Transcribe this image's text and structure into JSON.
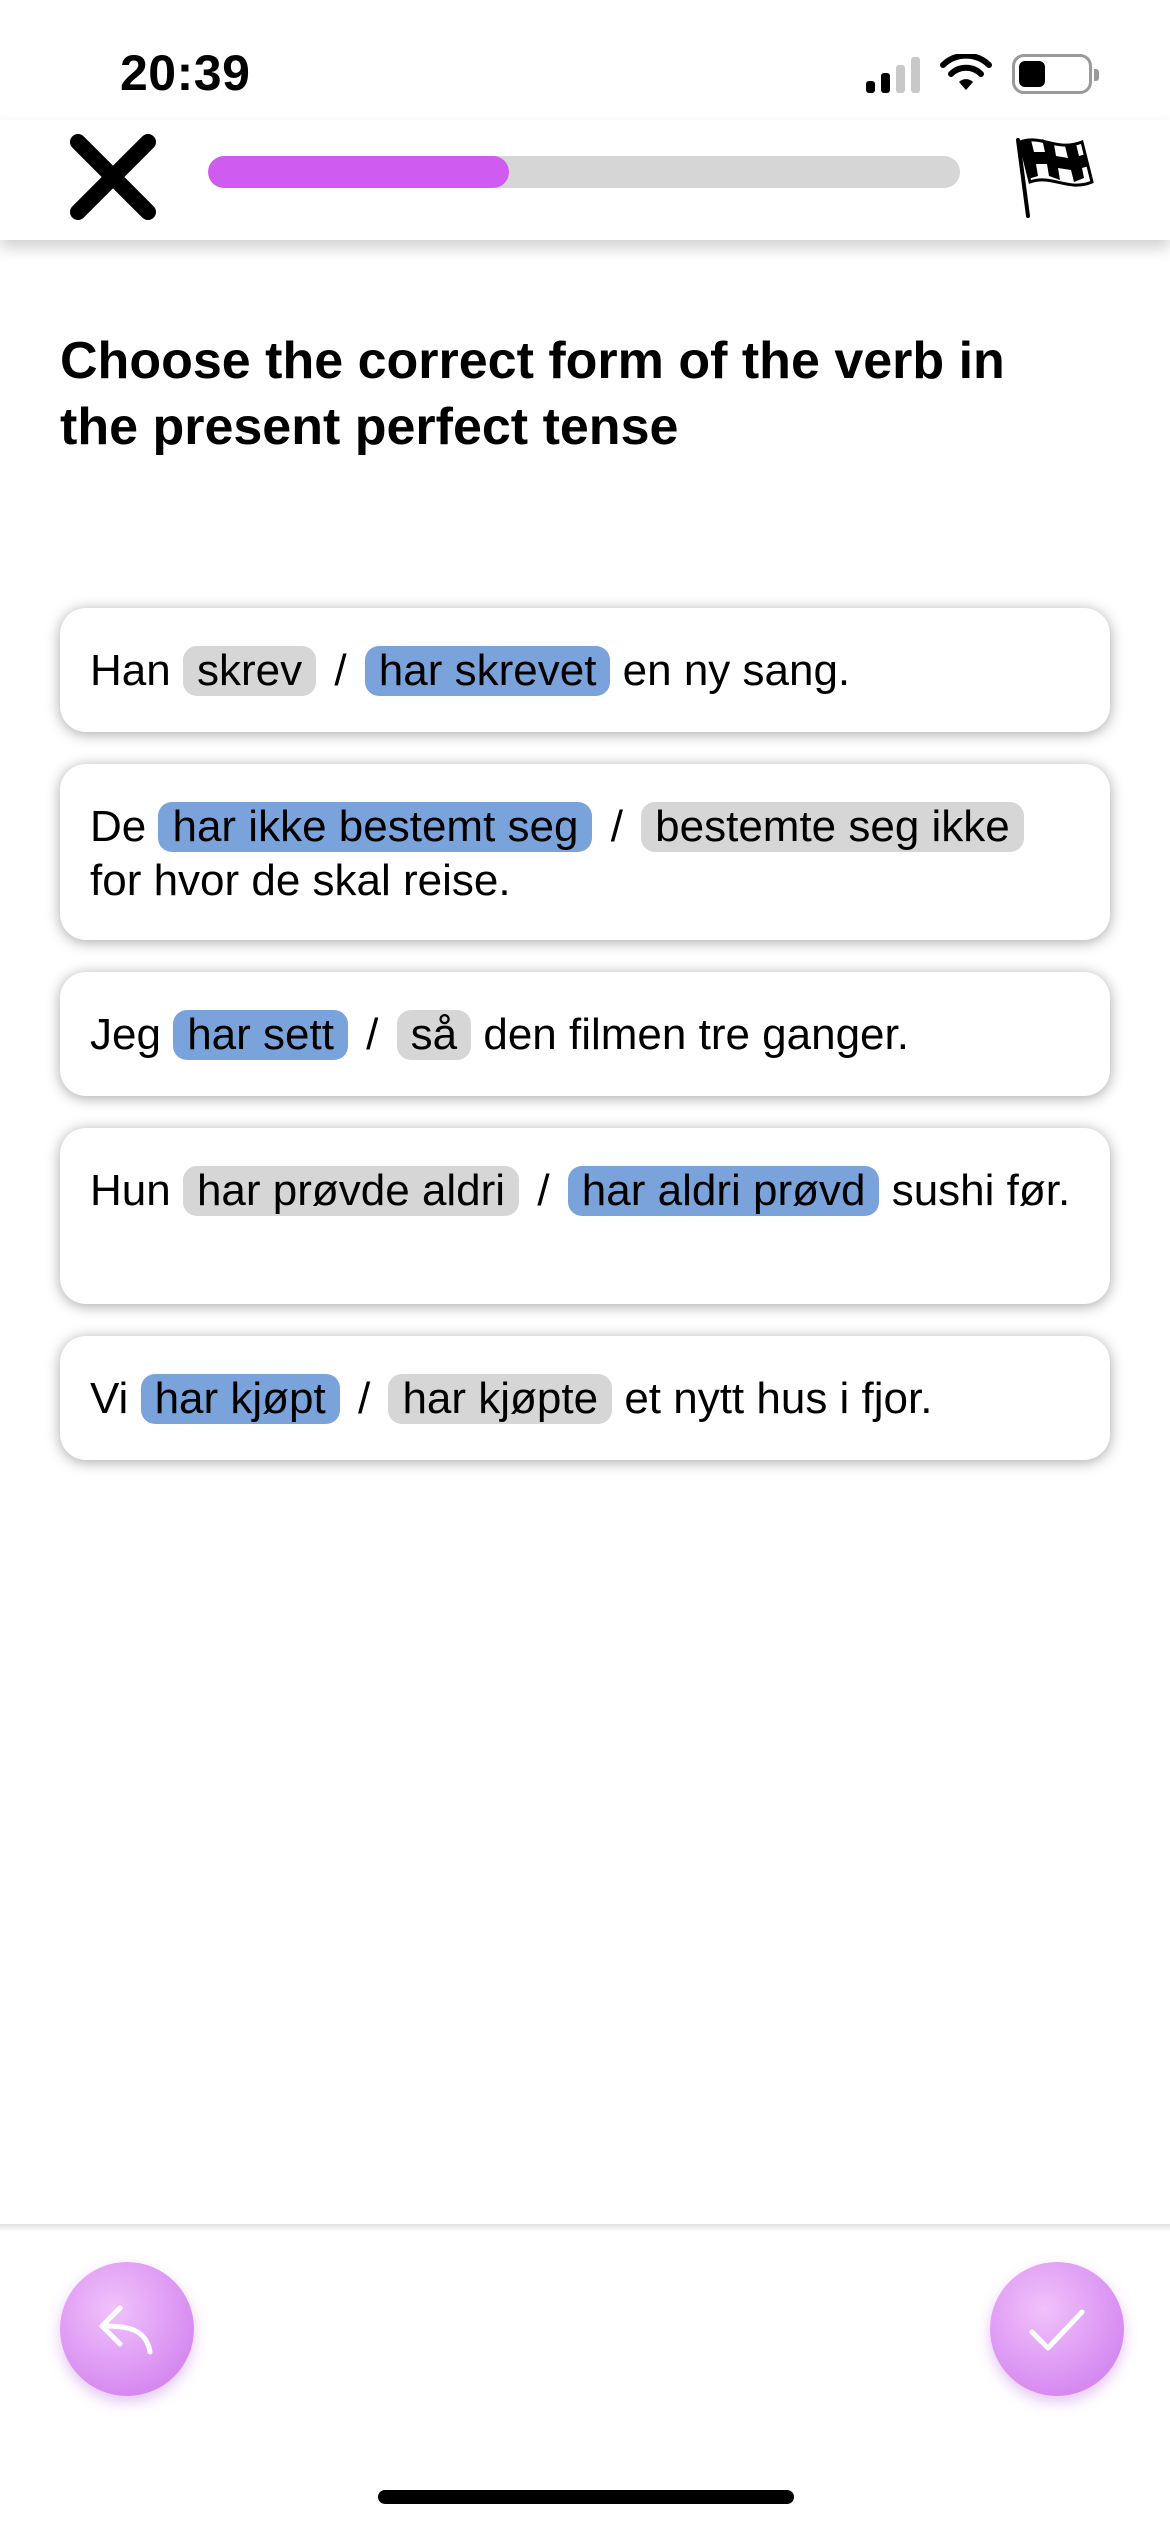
{
  "status": {
    "time": "20:39",
    "battery_level": 0.4
  },
  "header": {
    "progress": 0.4,
    "progress_color": "#cf5bf0",
    "icons": [
      "close-icon",
      "checkered-flag-icon"
    ]
  },
  "instruction": "Choose the correct form of the verb in the present perfect tense",
  "items": [
    {
      "before": "Han",
      "option_a": "skrev",
      "separator": "/",
      "option_b": "har skrevet",
      "after": "en ny sang.",
      "selected": "b"
    },
    {
      "before": "De",
      "option_a": "har ikke bestemt seg",
      "separator": "/",
      "option_b": "bestemte seg ikke",
      "after": "for hvor de skal reise.",
      "selected": "a"
    },
    {
      "before": "Jeg",
      "option_a": "har sett",
      "separator": "/",
      "option_b": "så",
      "after": "den filmen tre ganger.",
      "selected": "a"
    },
    {
      "before": "Hun",
      "option_a": "har prøvde aldri",
      "separator": "/",
      "option_b": "har aldri prøvd",
      "after": "sushi før.",
      "selected": "b"
    },
    {
      "before": "Vi",
      "option_a": "har kjøpt",
      "separator": "/",
      "option_b": "har kjøpte",
      "after": "et nytt hus i fjor.",
      "selected": "a"
    }
  ],
  "colors": {
    "selected_chip": "#7aa3dc",
    "unselected_chip": "#d6d6d6",
    "action_button": "#d78cf1"
  },
  "footer": {
    "icons": [
      "undo-icon",
      "checkmark-icon"
    ]
  }
}
